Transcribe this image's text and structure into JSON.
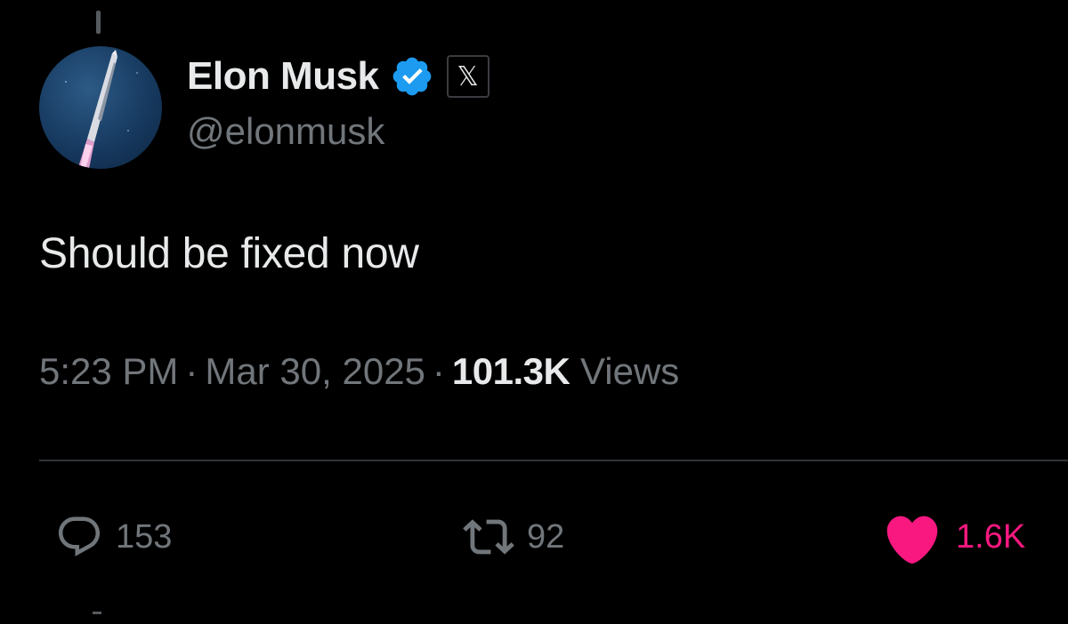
{
  "author": {
    "display_name": "Elon Musk",
    "handle": "@elonmusk",
    "verified": true,
    "badge_glyph": "𝕏",
    "verified_color": "#1d9bf0"
  },
  "tweet": {
    "text": "Should be fixed now",
    "time": "5:23 PM",
    "separator": "·",
    "date": "Mar 30, 2025",
    "views_count": "101.3K",
    "views_label": "Views"
  },
  "actions": {
    "reply": {
      "icon": "reply-icon",
      "count": "153"
    },
    "retweet": {
      "icon": "retweet-icon",
      "count": "92"
    },
    "like": {
      "icon": "heart-icon",
      "count": "1.6K",
      "active": true,
      "color": "#f91880"
    }
  },
  "colors": {
    "background": "#000000",
    "primary_text": "#e7e9ea",
    "secondary_text": "#71767b",
    "divider": "#2f3336"
  }
}
